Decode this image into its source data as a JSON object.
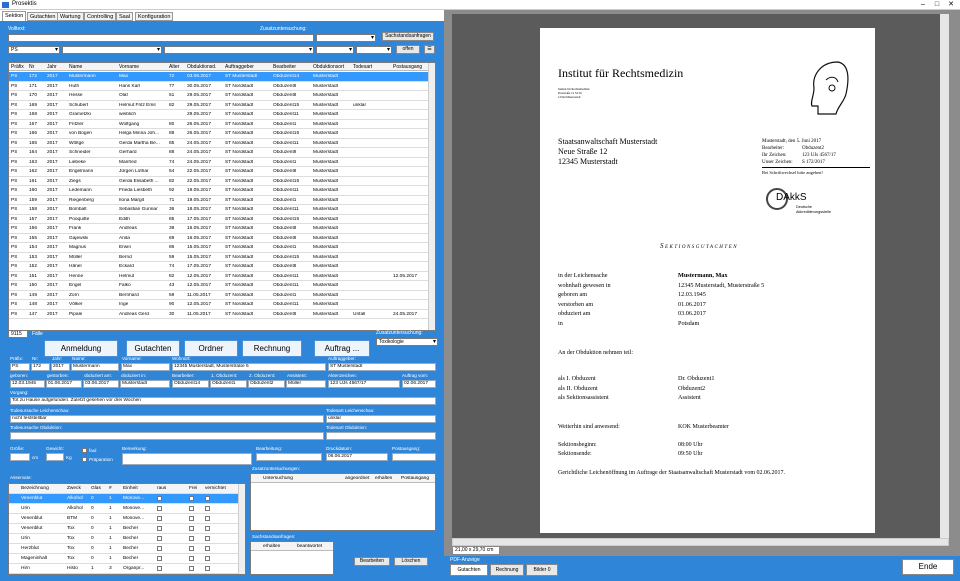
{
  "app": {
    "title": "Prosektis",
    "min": "–",
    "max": "□",
    "close": "✕"
  },
  "tabs": [
    "Sektion",
    "Gutachten",
    "Wartung",
    "Controlling",
    "Saal",
    "Konfiguration"
  ],
  "filter": {
    "volltext_label": "Volltext:",
    "zusatz_label": "Zusatzuntersuchung:",
    "sachstand_btn": "Sachstandsanfragen",
    "prefix_value": "PS",
    "offen_btn": "offen",
    "clear_btn": "☰"
  },
  "grid": {
    "headers": [
      "Präfix",
      "Nr",
      "Jahr",
      "Name",
      "Vorname",
      "Alter",
      "Obduktionsd.",
      "Auftraggeber",
      "Bearbeiter",
      "Obduktionsort",
      "Todesart",
      "Postausgang"
    ],
    "rows": [
      [
        "PS",
        "172",
        "2017",
        "Mustermann",
        "Max",
        "72",
        "03.06.2017",
        "ST Musterstadt",
        "Obduzent14",
        "Musterstadt",
        "",
        ""
      ],
      [
        "PS",
        "171",
        "2017",
        "Huth",
        "Hans Karl",
        "77",
        "30.05.2017",
        "ST Nordstadt",
        "Obduzent9",
        "Musterstadt",
        "",
        ""
      ],
      [
        "PS",
        "170",
        "2017",
        "Hesse",
        "Olaf",
        "51",
        "29.05.2017",
        "ST Nordstadt",
        "Obduzent8",
        "Musterstadt",
        "",
        ""
      ],
      [
        "PS",
        "169",
        "2017",
        "Schubert",
        "Helmut Fritz Emil",
        "82",
        "29.05.2017",
        "ST Nordstadt",
        "Obduzent15",
        "Musterstadt",
        "unklar",
        ""
      ],
      [
        "PS",
        "168",
        "2017",
        "Grametzki",
        "weiblich",
        "",
        "29.05.2017",
        "ST Nordstadt",
        "Obduzent11",
        "Musterstadt",
        "",
        ""
      ],
      [
        "PS",
        "167",
        "2017",
        "Fritzler",
        "Wolfgang",
        "80",
        "26.05.2017",
        "ST Nordstadt",
        "Obduzent1",
        "Musterstadt",
        "",
        ""
      ],
      [
        "PS",
        "166",
        "2017",
        "von Bogen",
        "Helga Minna Joh...",
        "88",
        "26.05.2017",
        "ST Nordstadt",
        "Obduzent15",
        "Musterstadt",
        "",
        ""
      ],
      [
        "PS",
        "165",
        "2017",
        "Wöltge",
        "Gerda Martha Be...",
        "85",
        "24.05.2017",
        "ST Nordstadt",
        "Obduzent11",
        "Musterstadt",
        "",
        ""
      ],
      [
        "PS",
        "164",
        "2017",
        "Schneider",
        "Gerhard",
        "88",
        "24.05.2017",
        "ST Nordstadt",
        "Obduzent9",
        "Musterstadt",
        "",
        ""
      ],
      [
        "PS",
        "163",
        "2017",
        "Liebeke",
        "Manfred",
        "74",
        "24.05.2017",
        "ST Nordstadt",
        "Obduzent1",
        "Musterstadt",
        "",
        ""
      ],
      [
        "PS",
        "162",
        "2017",
        "Engelmann",
        "Jürgen Lothar",
        "54",
        "22.05.2017",
        "ST Nordstadt",
        "Obduzent8",
        "Musterstadt",
        "",
        ""
      ],
      [
        "PS",
        "161",
        "2017",
        "Ziegs",
        "Gerda Elisabeth ...",
        "82",
        "22.05.2017",
        "ST Nordstadt",
        "Obduzent15",
        "Musterstadt",
        "",
        ""
      ],
      [
        "PS",
        "160",
        "2017",
        "Ledemann",
        "Frieda Liesbeth",
        "92",
        "19.05.2017",
        "ST Nordstadt",
        "Obduzent11",
        "Musterstadt",
        "",
        ""
      ],
      [
        "PS",
        "159",
        "2017",
        "Riegenberg",
        "Ilona Margit",
        "71",
        "19.05.2017",
        "ST Nordstadt",
        "Obduzent1",
        "Musterstadt",
        "",
        ""
      ],
      [
        "PS",
        "158",
        "2017",
        "Bombalt",
        "Sebastian Gunnar",
        "36",
        "18.05.2017",
        "ST Nordstadt",
        "Obduzent11",
        "Musterstadt",
        "",
        ""
      ],
      [
        "PS",
        "157",
        "2017",
        "Pooquitte",
        "Edith",
        "85",
        "17.05.2017",
        "ST Nordstadt",
        "Obduzent15",
        "Musterstadt",
        "",
        ""
      ],
      [
        "PS",
        "156",
        "2017",
        "Frank",
        "Andreas",
        "39",
        "16.05.2017",
        "ST Nordstadt",
        "Obduzent8",
        "Musterstadt",
        "",
        ""
      ],
      [
        "PS",
        "155",
        "2017",
        "Gajewski",
        "Anita",
        "69",
        "16.05.2017",
        "ST Nordstadt",
        "Obduzent9",
        "Musterstadt",
        "",
        ""
      ],
      [
        "PS",
        "154",
        "2017",
        "Magnus",
        "Erwin",
        "86",
        "15.05.2017",
        "ST Nordstadt",
        "Obduzent1",
        "Musterstadt",
        "",
        ""
      ],
      [
        "PS",
        "153",
        "2017",
        "Müller",
        "Bernd",
        "59",
        "15.05.2017",
        "ST Nordstadt",
        "Obduzent15",
        "Musterstadt",
        "",
        ""
      ],
      [
        "PS",
        "152",
        "2017",
        "Hänel",
        "Eckard",
        "74",
        "17.05.2017",
        "ST Nordstadt",
        "Obduzent8",
        "Musterstadt",
        "",
        ""
      ],
      [
        "PS",
        "151",
        "2017",
        "Henne",
        "Helmut",
        "82",
        "12.05.2017",
        "ST Nordstadt",
        "Obduzent11",
        "Musterstadt",
        "",
        "12.05.2017"
      ],
      [
        "PS",
        "150",
        "2017",
        "Engel",
        "Falko",
        "43",
        "12.05.2017",
        "ST Nordstadt",
        "Obduzent11",
        "Musterstadt",
        "",
        ""
      ],
      [
        "PS",
        "149",
        "2017",
        "Zorn",
        "Bernhard",
        "59",
        "11.05.2017",
        "ST Nordstadt",
        "Obduzent1",
        "Musterstadt",
        "",
        ""
      ],
      [
        "PS",
        "148",
        "2017",
        "Völker",
        "Inge",
        "90",
        "12.05.2017",
        "ST Nordstadt",
        "Obduzent11",
        "Musterstadt",
        "",
        ""
      ],
      [
        "PS",
        "147",
        "2017",
        "Pipale",
        "Andreas Gerd",
        "30",
        "11.05.2017",
        "ST Nordstadt",
        "Obduzent9",
        "Musterstadt",
        "Unfall",
        "24.05.2017"
      ]
    ]
  },
  "count": {
    "value": "9115",
    "label": "Fälle"
  },
  "actions": {
    "anmeldung": "Anmeldung",
    "gutachten": "Gutachten",
    "ordner": "Ordner",
    "rechnung": "Rechnung",
    "auftrag": "Auftrag ...",
    "zusatz_label": "Zusatzuntersuchung:",
    "zusatz_value": "Toxikologie"
  },
  "detail": {
    "l1": [
      "Präfix:",
      "Nr:",
      "Jahr:",
      "Name:",
      "Vorname:",
      "Wohnort:",
      "Auftraggeber:"
    ],
    "v1": [
      "PS",
      "172",
      "2017",
      "Mustermann",
      "Max",
      "12345 Musterstadt, Musterstraße 5",
      "ST Musterstadt"
    ],
    "l2": [
      "geboren:",
      "gestorben:",
      "obduziert am:",
      "obduziert in:",
      "Bearbeiter:",
      "1. Obduzent:",
      "2. Obduzent:",
      "Assistent:",
      "Aktenzeichen:",
      "Auftrag vom:"
    ],
    "v2": [
      "12.03.1945",
      "01.06.2017",
      "03.06.2017",
      "Musterstadt",
      "Obduzent14",
      "Obduzent1",
      "Obduzent2",
      "Müller",
      "123 UJs 4567/17",
      "02.06.2017"
    ],
    "vorgang_label": "Vorgang:",
    "vorgang": "Tot zu Hause aufgefunden. Zuletzt gesehen vor drei Wochen",
    "tu_label": "Todesursache Leichenschau:",
    "tu": "nicht feststellbar",
    "ta_label": "Todesart Leichenschau:",
    "ta": "unklar",
    "tuo_label": "Todesursache Obduktion:",
    "tao_label": "Todesart Obduktion:",
    "groesse_label": "Größe:",
    "cm": "cm",
    "gewicht_label": "Gewicht:",
    "kg": "Kg",
    "faul": "faul",
    "praep": "Präparation",
    "bem_label": "Bemerkung:",
    "bearb_label": "Bearbeitung:",
    "druck_label": "Druckdatum:",
    "druck": "06.06.2017",
    "post_label": "Postausgang:"
  },
  "asservate": {
    "label": "Asservate:",
    "headers": [
      "Bezeichnung",
      "Zweck",
      "Glas",
      "#",
      "Einheit",
      "raus",
      "Frei",
      "vernichtet"
    ],
    "rows": [
      [
        "Venenblut",
        "Alkohol",
        "0",
        "1",
        "Monove..."
      ],
      [
        "Urin",
        "Alkohol",
        "0",
        "1",
        "Monove..."
      ],
      [
        "Venenblut",
        "BTM",
        "0",
        "1",
        "Monove..."
      ],
      [
        "Venenblut",
        "Tox",
        "0",
        "1",
        "Becher"
      ],
      [
        "Urin",
        "Tox",
        "0",
        "1",
        "Becher"
      ],
      [
        "Herzblut",
        "Tox",
        "0",
        "1",
        "Becher"
      ],
      [
        "Mageninhalt",
        "Tox",
        "0",
        "1",
        "Becher"
      ],
      [
        "Hirn",
        "Histo",
        "1",
        "3",
        "Organpr..."
      ]
    ]
  },
  "zusatz": {
    "label": "Zusatzuntersuchungen:",
    "headers": [
      "Untersuchung",
      "angeordnet",
      "erhalten",
      "Postausgang"
    ]
  },
  "sachstand": {
    "label": "Sachstandsanfragen:",
    "headers": [
      "erhalten",
      "beantwortet"
    ]
  },
  "lower_buttons": {
    "bearbeiten": "Bearbeiten",
    "loeschen": "Löschen"
  },
  "pdf": {
    "institute": "Institut für Rechtsmedizin",
    "small": [
      "Institut für Rechtsmedizin",
      "Poststraße 12 34 56",
      "12344 Musterstadt"
    ],
    "addr": [
      "Staatsanwaltschaft Musterstadt",
      "Neue Straße 12",
      "12345 Musterstadt"
    ],
    "meta": [
      "Musterstadt, den 5. Juni 2017",
      "Bearbeiter:",
      "Obduzent2",
      "Ihr Zeichen:",
      "123 UJs 4567/17",
      "Unser Zeichen:",
      "S 172/2017",
      "Bei Schriftwechsel bitte angeben!"
    ],
    "dakks": "DAkkS",
    "dakks_sub": [
      "Deutsche",
      "Akkreditierungsstelle"
    ],
    "heading": "Sektionsgutachten",
    "facts": [
      [
        "in der Leichensache",
        "Mustermann, Max"
      ],
      [
        "wohnhaft gewesen in",
        "12345 Musterstadt, Musterstraße 5"
      ],
      [
        "geboren am",
        "12.03.1945"
      ],
      [
        "verstorben am",
        "01.06.2017"
      ],
      [
        "obduziert am",
        "03.06.2017"
      ],
      [
        "in",
        "Potsdam"
      ]
    ],
    "teil": "An der Obduktion nehmen teil:",
    "people": [
      [
        "als I. Obduzent",
        "Dr. Obduzent1"
      ],
      [
        "als II. Obduzent",
        "Obduzent2"
      ],
      [
        "als Sektionsassistent",
        "Assistent"
      ]
    ],
    "weiter": [
      "Weiterhin sind anwesend:",
      "KOK Musterbeamter"
    ],
    "times": [
      [
        "Sektionsbeginn:",
        "08:00 Uhr"
      ],
      [
        "Sektionsende:",
        "09:50 Uhr"
      ]
    ],
    "closing": "Gerichtliche Leichenöffnung im Auftrage der Staatsanwaltschaft Musterstadt vom 02.06.2017.",
    "pagesize": "21,00 x 29,70 cm"
  },
  "pdf_tabs": {
    "label": "PDF-Anzeige",
    "items": [
      "Gutachten",
      "Rechnung",
      "Bilder 0"
    ]
  },
  "ende": "Ende"
}
